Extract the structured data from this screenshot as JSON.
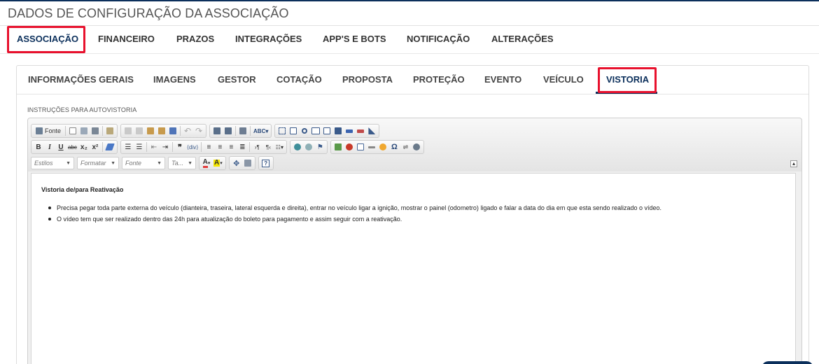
{
  "page": {
    "title": "DADOS DE CONFIGURAÇÃO DA ASSOCIAÇÃO"
  },
  "main_tabs": [
    {
      "label": "ASSOCIAÇÃO",
      "active": true
    },
    {
      "label": "FINANCEIRO"
    },
    {
      "label": "PRAZOS"
    },
    {
      "label": "INTEGRAÇÕES"
    },
    {
      "label": "APP'S E BOTS"
    },
    {
      "label": "NOTIFICAÇÃO"
    },
    {
      "label": "ALTERAÇÕES"
    }
  ],
  "sub_tabs": [
    {
      "label": "INFORMAÇÕES GERAIS"
    },
    {
      "label": "IMAGENS"
    },
    {
      "label": "GESTOR"
    },
    {
      "label": "COTAÇÃO"
    },
    {
      "label": "PROPOSTA"
    },
    {
      "label": "PROTEÇÃO"
    },
    {
      "label": "EVENTO"
    },
    {
      "label": "VEÍCULO"
    },
    {
      "label": "VISTORIA",
      "active": true
    }
  ],
  "field": {
    "label": "INSTRUÇÕES PARA AUTOVISTORIA"
  },
  "editor": {
    "toolbar": {
      "source_label": "Fonte",
      "bold": "B",
      "italic": "I",
      "underline": "U",
      "strike": "abc",
      "subscript": "x₂",
      "superscript": "x²",
      "combos": {
        "styles": "Estilos",
        "format": "Formatar",
        "font": "Fonte",
        "size": "Ta..."
      },
      "text_color": "A",
      "bg_color": "A",
      "help": "?",
      "omega": "Ω"
    },
    "content": {
      "heading": "Vistoria de/para Reativação",
      "items": [
        "Precisa pegar toda parte externa do veículo (dianteira, traseira, lateral esquerda e direita), entrar no veículo ligar a ignição, mostrar o painel (odometro) ligado e falar a data do dia em que esta sendo realizado o vídeo.",
        "O vídeo tem que ser realizado dentro das 24h para atualização do boleto para pagamento e assim seguir com a reativação."
      ]
    }
  },
  "colors": {
    "accent": "#0b2f5b",
    "highlight": "#e8112d"
  }
}
